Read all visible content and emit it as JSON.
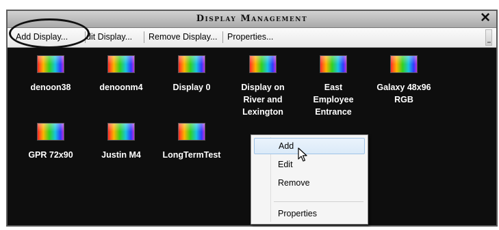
{
  "window": {
    "title": "Display Management",
    "close_glyph": "✕"
  },
  "toolbar": {
    "add_label": "Add Display...",
    "edit_label": "dit Display...",
    "remove_label": "Remove Display...",
    "properties_label": "Properties..."
  },
  "displays": [
    {
      "label": "denoon38",
      "icon": "display-icon"
    },
    {
      "label": "denoonm4",
      "icon": "display-icon"
    },
    {
      "label": "Display 0",
      "icon": "display-icon"
    },
    {
      "label": "Display on River and Lexington",
      "icon": "display-icon"
    },
    {
      "label": "East Employee Entrance",
      "icon": "display-icon"
    },
    {
      "label": "Galaxy 48x96 RGB",
      "icon": "display-icon"
    },
    {
      "label": "GPR 72x90",
      "icon": "display-icon"
    },
    {
      "label": "Justin M4",
      "icon": "display-icon"
    },
    {
      "label": "LongTermTest",
      "icon": "display-icon"
    }
  ],
  "context_menu": {
    "items": [
      {
        "label": "Add"
      },
      {
        "label": "Edit"
      },
      {
        "label": "Remove"
      },
      {
        "label": "Properties"
      }
    ]
  },
  "colors": {
    "background": "#0e0e0e",
    "highlight": "#dbeaf8",
    "annotation": "#111111"
  }
}
